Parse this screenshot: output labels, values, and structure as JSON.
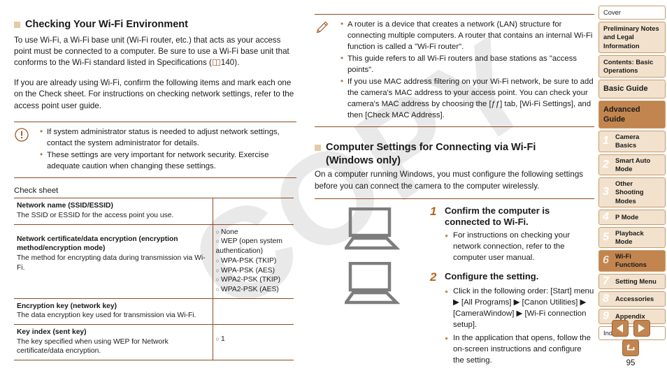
{
  "left_column": {
    "heading": "Checking Your Wi-Fi Environment",
    "para1_a": "To use Wi-Fi, a Wi-Fi base unit (Wi-Fi router, etc.) that acts as your access point must be connected to a computer. Be sure to use a Wi-Fi base unit that conforms to the Wi-Fi standard listed in Specifications (",
    "para1_b": "140).",
    "para2": "If you are already using Wi-Fi, confirm the following items and mark each one on the Check sheet. For instructions on checking network settings, refer to the access point user guide.",
    "caution_items": [
      "If system administrator status is needed to adjust network settings, contact the system administrator for details.",
      "These settings are very important for network security. Exercise adequate caution when changing these settings."
    ],
    "check_sheet_label": "Check sheet",
    "table": [
      {
        "title": "Network name (SSID/ESSID)",
        "desc": "The SSID or ESSID for the access point you use.",
        "options": []
      },
      {
        "title": "Network certificate/data encryption (encryption method/encryption mode)",
        "desc": "The method for encrypting data during transmission via Wi-Fi.",
        "options": [
          "None",
          "WEP (open system authentication)",
          "WPA-PSK (TKIP)",
          "WPA-PSK (AES)",
          "WPA2-PSK (TKIP)",
          "WPA2-PSK (AES)"
        ]
      },
      {
        "title": "Encryption key (network key)",
        "desc": "The data encryption key used for transmission via Wi-Fi.",
        "options": []
      },
      {
        "title": "Key index (sent key)",
        "desc": "The key specified when using WEP for Network certificate/data encryption.",
        "options": [
          "1"
        ]
      }
    ]
  },
  "right_column": {
    "note_items": [
      "A router is a device that creates a network (LAN) structure for connecting multiple computers. A router that contains an internal Wi-Fi function is called a \"Wi-Fi router\".",
      "This guide refers to all Wi-Fi routers and base stations as \"access points\".",
      "If you use MAC address filtering on your Wi-Fi network, be sure to add the camera's MAC address to your access point. You can check your camera's MAC address by choosing the [ƒƒ] tab, [Wi-Fi Settings], and then [Check MAC Address]."
    ],
    "heading_line1": "Computer Settings for Connecting via Wi-Fi",
    "heading_line2": "(Windows only)",
    "intro": "On a computer running Windows, you must configure the following settings before you can connect the camera to the computer wirelessly.",
    "steps": [
      {
        "number": "1",
        "title": "Confirm the computer is connected to Wi-Fi.",
        "bullets": [
          "For instructions on checking your network connection, refer to the computer user manual."
        ]
      },
      {
        "number": "2",
        "title": "Configure the setting.",
        "bullets": [
          "Click in the following order: [Start] menu ▶ [All Programs] ▶ [Canon Utilities] ▶ [CameraWindow] ▶ [Wi-Fi connection setup].",
          "In the application that opens, follow the on-screen instructions and configure the setting."
        ]
      }
    ]
  },
  "sidebar": {
    "items": [
      {
        "label": "Cover",
        "number": "",
        "style": "plain"
      },
      {
        "label": "Preliminary Notes and Legal Information",
        "number": "",
        "style": "plain"
      },
      {
        "label": "Contents: Basic Operations",
        "number": "",
        "style": "plain"
      },
      {
        "label": "Basic Guide",
        "number": "",
        "style": "big"
      },
      {
        "label": "Advanced Guide",
        "number": "",
        "style": "accent"
      },
      {
        "label": "Camera Basics",
        "number": "1",
        "style": "numbered"
      },
      {
        "label": "Smart Auto Mode",
        "number": "2",
        "style": "numbered"
      },
      {
        "label": "Other Shooting Modes",
        "number": "3",
        "style": "numbered"
      },
      {
        "label": "P Mode",
        "number": "4",
        "style": "numbered"
      },
      {
        "label": "Playback Mode",
        "number": "5",
        "style": "numbered"
      },
      {
        "label": "Wi-Fi Functions",
        "number": "6",
        "style": "active"
      },
      {
        "label": "Setting Menu",
        "number": "7",
        "style": "numbered"
      },
      {
        "label": "Accessories",
        "number": "8",
        "style": "numbered"
      },
      {
        "label": "Appendix",
        "number": "9",
        "style": "numbered"
      },
      {
        "label": "Index",
        "number": "",
        "style": "plain"
      }
    ]
  },
  "controls": {
    "page_number": "95"
  },
  "watermark": {
    "text": "COPY"
  },
  "colors": {
    "accent_brown": "#8c4a26",
    "nav_tan": "#f2e2cd",
    "nav_active": "#c2854f",
    "bullet_orange": "#d08c4a",
    "watermark_gray": "#e9e9e9"
  }
}
